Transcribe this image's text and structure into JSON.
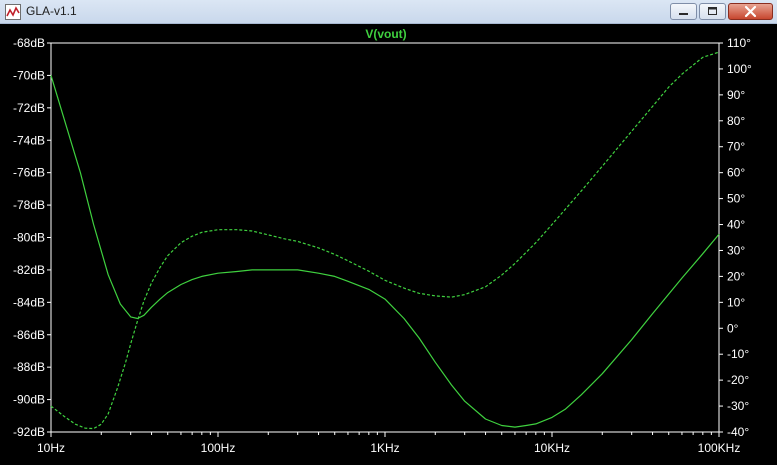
{
  "window": {
    "title": "GLA-v1.1",
    "controls": [
      "minimize",
      "maximize",
      "close"
    ]
  },
  "colors": {
    "background": "#000000",
    "axis": "#ffffff",
    "trace": "#3fd13f",
    "title_bar": "#dbe6f4"
  },
  "chart_data": {
    "type": "line",
    "title": "V(vout)",
    "xscale": "log",
    "x_ticks": [
      "10Hz",
      "100Hz",
      "1KHz",
      "10KHz",
      "100KHz"
    ],
    "xlim": [
      10,
      100000
    ],
    "y_left_ticks": [
      "-68dB",
      "-70dB",
      "-72dB",
      "-74dB",
      "-76dB",
      "-78dB",
      "-80dB",
      "-82dB",
      "-84dB",
      "-86dB",
      "-88dB",
      "-90dB",
      "-92dB"
    ],
    "y_right_ticks": [
      "110°",
      "100°",
      "90°",
      "80°",
      "70°",
      "60°",
      "50°",
      "40°",
      "30°",
      "20°",
      "10°",
      "0°",
      "-10°",
      "-20°",
      "-30°",
      "-40°"
    ],
    "ylim_left": [
      -92,
      -68
    ],
    "ylim_right": [
      -40,
      110
    ],
    "grid": false,
    "series": [
      {
        "style": "solid",
        "axis": "left",
        "x": [
          10,
          12,
          15,
          18,
          22,
          26,
          30,
          33,
          36,
          40,
          45,
          50,
          60,
          70,
          80,
          100,
          130,
          160,
          200,
          250,
          300,
          400,
          500,
          600,
          800,
          1000,
          1300,
          1600,
          2000,
          2500,
          3000,
          4000,
          5000,
          6000,
          7000,
          8000,
          10000,
          12000,
          15000,
          20000,
          30000,
          40000,
          60000,
          80000,
          100000
        ],
        "y": [
          -70.0,
          -72.7,
          -76.0,
          -79.2,
          -82.3,
          -84.1,
          -84.9,
          -85.0,
          -84.8,
          -84.3,
          -83.8,
          -83.4,
          -82.9,
          -82.6,
          -82.4,
          -82.2,
          -82.1,
          -82.0,
          -82.0,
          -82.0,
          -82.0,
          -82.2,
          -82.4,
          -82.7,
          -83.2,
          -83.8,
          -85.0,
          -86.2,
          -87.7,
          -89.1,
          -90.1,
          -91.2,
          -91.6,
          -91.7,
          -91.6,
          -91.5,
          -91.1,
          -90.6,
          -89.7,
          -88.4,
          -86.3,
          -84.7,
          -82.5,
          -81.0,
          -79.8
        ]
      },
      {
        "style": "dashed",
        "axis": "right",
        "x": [
          10,
          12,
          14,
          16,
          18,
          20,
          22,
          25,
          28,
          30,
          33,
          36,
          40,
          45,
          50,
          60,
          70,
          80,
          100,
          130,
          160,
          200,
          250,
          300,
          400,
          500,
          600,
          800,
          1000,
          1300,
          1600,
          2000,
          2500,
          3000,
          4000,
          5000,
          6000,
          8000,
          10000,
          15000,
          20000,
          30000,
          40000,
          50000,
          60000,
          80000,
          100000
        ],
        "y": [
          -30.0,
          -34.0,
          -37.0,
          -38.5,
          -38.7,
          -37.0,
          -33.0,
          -23.0,
          -13.0,
          -6.0,
          3.0,
          10.5,
          17.5,
          23.5,
          28.0,
          33.0,
          35.5,
          37.0,
          38.0,
          38.0,
          37.5,
          36.0,
          34.5,
          33.5,
          31.0,
          28.5,
          26.0,
          22.0,
          18.5,
          15.5,
          13.5,
          12.5,
          12.0,
          13.0,
          16.0,
          20.5,
          25.0,
          33.0,
          40.0,
          53.0,
          62.5,
          76.0,
          85.5,
          93.0,
          98.0,
          104.5,
          106.5
        ]
      }
    ]
  }
}
